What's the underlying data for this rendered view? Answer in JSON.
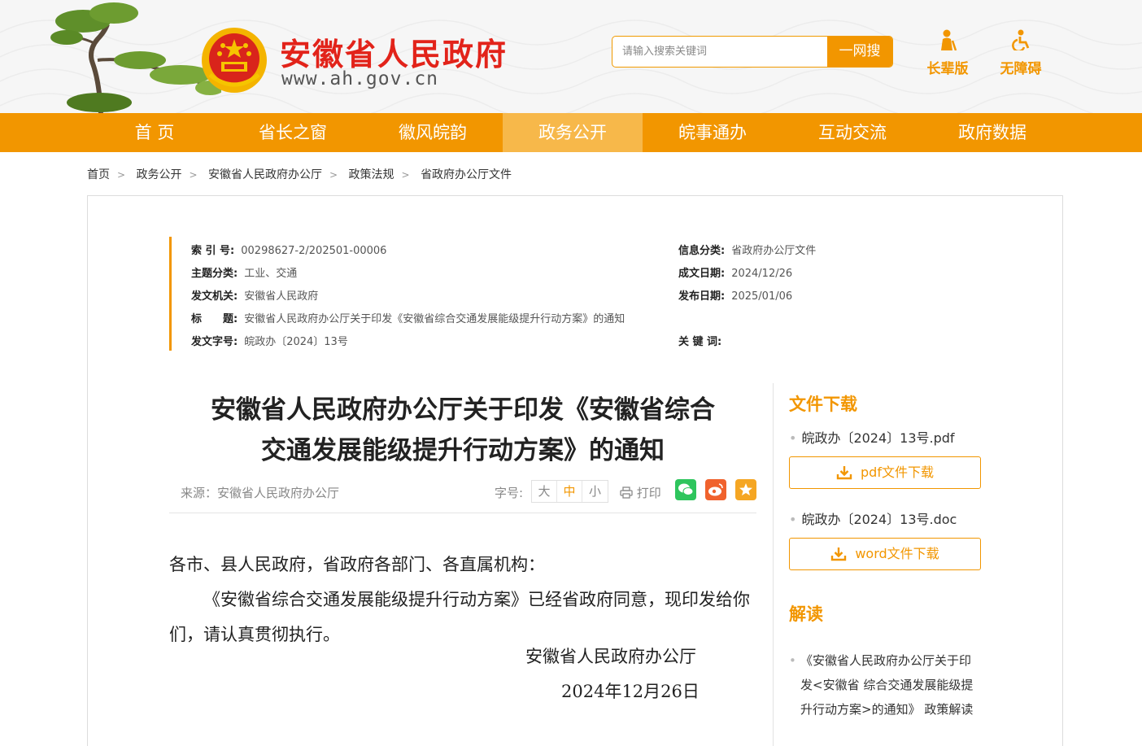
{
  "header": {
    "site_title": "安徽省人民政府",
    "site_url": "www.ah.gov.cn",
    "search": {
      "placeholder": "请输入搜索关键词",
      "button_label": "一网搜"
    },
    "tools": {
      "elder_label": "长辈版",
      "accessibility_label": "无障碍"
    }
  },
  "nav": {
    "items": [
      "首 页",
      "省长之窗",
      "徽风皖韵",
      "政务公开",
      "皖事通办",
      "互动交流",
      "政府数据"
    ],
    "active_index": 3
  },
  "breadcrumb": [
    "首页",
    "政务公开",
    "安徽省人民政府办公厅",
    "政策法规",
    "省政府办公厅文件"
  ],
  "meta": {
    "index_key": "索 引 号:",
    "index_val": "00298627-2/202501-00006",
    "topic_key": "主题分类:",
    "topic_val": "工业、交通",
    "issuer_key": "发文机关:",
    "issuer_val": "安徽省人民政府",
    "title_key": "标　　题:",
    "title_val": "安徽省人民政府办公厅关于印发《安徽省综合交通发展能级提升行动方案》的通知",
    "docno_key": "发文字号:",
    "docno_val": "皖政办〔2024〕13号",
    "category_key": "信息分类:",
    "category_val": "省政府办公厅文件",
    "created_key": "成文日期:",
    "created_val": "2024/12/26",
    "published_key": "发布日期:",
    "published_val": "2025/01/06",
    "keywords_key": "关 键 词:",
    "keywords_val": ""
  },
  "article": {
    "title_line1": "安徽省人民政府办公厅关于印发《安徽省综合",
    "title_line2": "交通发展能级提升行动方案》的通知",
    "source": "来源：安徽省人民政府办公厅",
    "font_size_label": "字号:",
    "font_sizes": [
      "大",
      "中",
      "小"
    ],
    "print_label": "打印",
    "salutation": "各市、县人民政府，省政府各部门、各直属机构：",
    "body": "《安徽省综合交通发展能级提升行动方案》已经省政府同意，现印发给你们，请认真贯彻执行。",
    "sign_org": "安徽省人民政府办公厅",
    "sign_date": "2024年12月26日"
  },
  "sidebar": {
    "download_heading": "文件下载",
    "files": [
      {
        "name": "皖政办〔2024〕13号.pdf",
        "button": "pdf文件下载"
      },
      {
        "name": "皖政办〔2024〕13号.doc",
        "button": "word文件下载"
      }
    ],
    "interp_heading": "解读",
    "interp_item": "《安徽省人民政府办公厅关于印发<安徽省 综合交通发展能级提升行动方案>的通知》 政策解读"
  },
  "colors": {
    "brand_orange": "#f29600",
    "title_red": "#e2231a"
  },
  "icons": [
    "pine-tree",
    "national-emblem",
    "elder-icon",
    "wheelchair-icon",
    "printer-icon",
    "wechat-icon",
    "weibo-icon",
    "star-icon",
    "download-icon"
  ]
}
